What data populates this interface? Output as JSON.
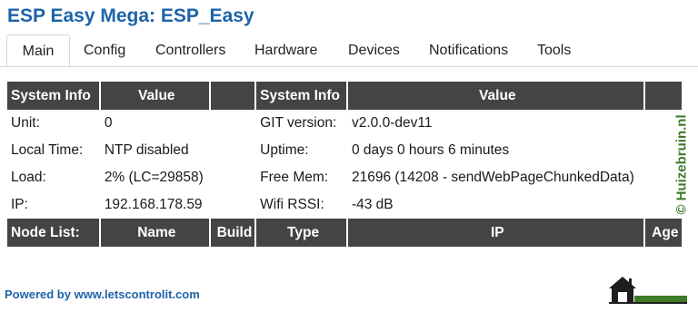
{
  "header": {
    "title": "ESP Easy Mega: ESP_Easy"
  },
  "tabs": [
    {
      "label": "Main",
      "active": true
    },
    {
      "label": "Config"
    },
    {
      "label": "Controllers"
    },
    {
      "label": "Hardware"
    },
    {
      "label": "Devices"
    },
    {
      "label": "Notifications"
    },
    {
      "label": "Tools"
    }
  ],
  "system_table": {
    "headers": [
      "System Info",
      "Value",
      "",
      "System Info",
      "Value",
      ""
    ],
    "rows": [
      {
        "l_label": "Unit:",
        "l_value": "0",
        "r_label": "GIT version:",
        "r_value": "v2.0.0-dev11"
      },
      {
        "l_label": "Local Time:",
        "l_value": "NTP disabled",
        "r_label": "Uptime:",
        "r_value": "0 days 0 hours 6 minutes"
      },
      {
        "l_label": "Load:",
        "l_value": "2% (LC=29858)",
        "r_label": "Free Mem:",
        "r_value": "21696 (14208 - sendWebPageChunkedData)"
      },
      {
        "l_label": "IP:",
        "l_value": "192.168.178.59",
        "r_label": "Wifi RSSI:",
        "r_value": "-43 dB"
      }
    ]
  },
  "node_table": {
    "headers": [
      "Node List:",
      "Name",
      "Build",
      "Type",
      "IP",
      "Age"
    ]
  },
  "footer": {
    "powered_by": "Powered by www.letscontrolit.com"
  },
  "watermark": {
    "text": "© Huizebruin.nl"
  },
  "colors": {
    "accent": "#1d63a8",
    "header_bg": "#444444",
    "watermark": "#3e7a27"
  }
}
